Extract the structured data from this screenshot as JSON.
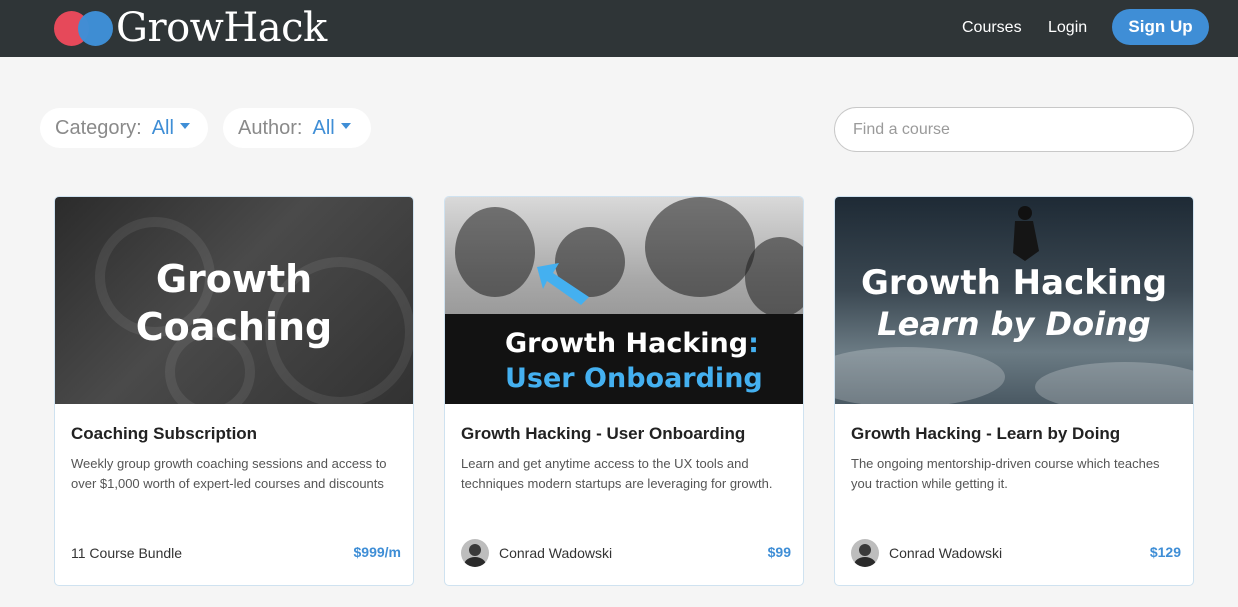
{
  "header": {
    "logo_text": "GrowHack",
    "logo_icon": "two-overlapping-circles",
    "nav": {
      "courses": "Courses",
      "login": "Login",
      "signup": "Sign Up"
    },
    "colors": {
      "bar": "#2f3537",
      "accent": "#3f8ed6",
      "logo_red": "#e6495a"
    }
  },
  "filters": {
    "category": {
      "label": "Category:",
      "value": "All"
    },
    "author": {
      "label": "Author:",
      "value": "All"
    }
  },
  "search": {
    "placeholder": "Find a course",
    "value": ""
  },
  "courses": [
    {
      "banner": {
        "line1": "Growth",
        "line2": "Coaching",
        "image": "engine-dark-photo"
      },
      "title": "Coaching Subscription",
      "description": "Weekly group growth coaching sessions and access to over $1,000 worth of expert-led courses and discounts",
      "author": "11 Course Bundle",
      "price": "$999/m"
    },
    {
      "banner": {
        "line1": "Growth Hacking",
        "colon": ":",
        "line2": "User Onboarding",
        "image": "crowd-surfing-photo"
      },
      "title": "Growth Hacking - User Onboarding",
      "description": "Learn and get anytime access to the UX tools and techniques modern startups are leveraging for growth.",
      "author": "Conrad Wadowski",
      "price": "$99"
    },
    {
      "banner": {
        "line1": "Growth Hacking",
        "line2": "Learn by Doing",
        "image": "surfer-wave-photo"
      },
      "title": "Growth Hacking - Learn by Doing",
      "description": "The ongoing mentorship-driven course which teaches you traction while getting it.",
      "author": "Conrad Wadowski",
      "price": "$129"
    }
  ]
}
